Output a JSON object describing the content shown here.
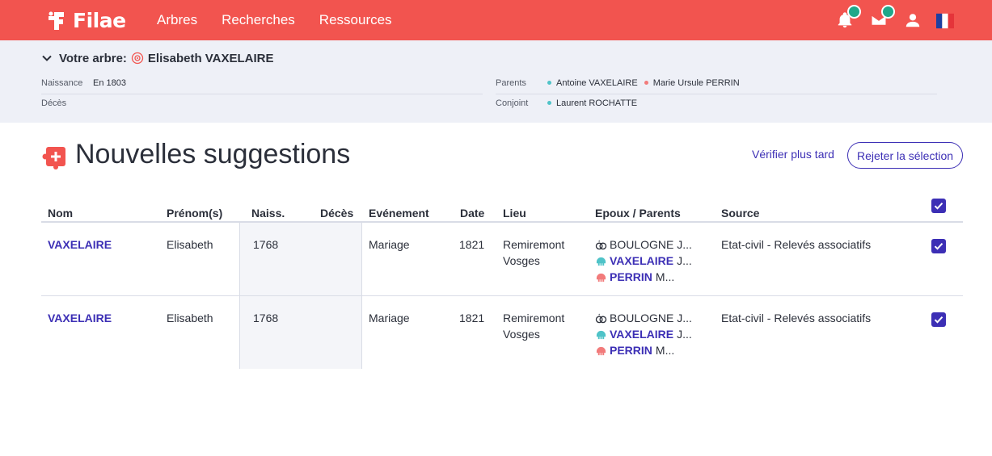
{
  "brand": {
    "name": "Filae"
  },
  "nav": {
    "items": [
      "Arbres",
      "Recherches",
      "Ressources"
    ]
  },
  "topbar": {
    "color": "#f2544f",
    "icons": [
      "bell-icon",
      "mail-icon",
      "user-icon",
      "french-flag-icon"
    ]
  },
  "tree": {
    "title_label": "Votre arbre:",
    "person": "Elisabeth VAXELAIRE",
    "birth_label": "Naissance",
    "birth_value": "En 1803",
    "death_label": "Décès",
    "death_value": "",
    "parents_label": "Parents",
    "parents": [
      "Antoine VAXELAIRE",
      "Marie Ursule PERRIN"
    ],
    "spouse_label": "Conjoint",
    "spouse": "Laurent ROCHATTE"
  },
  "suggestions": {
    "title": "Nouvelles suggestions",
    "later_label": "Vérifier plus tard",
    "reject_label": "Rejeter la sélection"
  },
  "table": {
    "headers": [
      "Nom",
      "Prénom(s)",
      "Naiss.",
      "Décès",
      "Evénement",
      "Date",
      "Lieu",
      "Epoux / Parents",
      "Source"
    ],
    "select_all_checked": true,
    "rows": [
      {
        "nom": "VAXELAIRE",
        "prenom": "Elisabeth",
        "naiss": "1768",
        "deces": "",
        "evenement": "Mariage",
        "date": "1821",
        "lieu_1": "Remiremont",
        "lieu_2": "Vosges",
        "epoux_name": "BOULOGNE J...",
        "pere_name": "VAXELAIRE",
        "pere_rest": "J...",
        "mere_name": "PERRIN",
        "mere_rest": "M...",
        "source": "Etat-civil - Relevés associatifs",
        "checked": true
      },
      {
        "nom": "VAXELAIRE",
        "prenom": "Elisabeth",
        "naiss": "1768",
        "deces": "",
        "evenement": "Mariage",
        "date": "1821",
        "lieu_1": "Remiremont",
        "lieu_2": "Vosges",
        "epoux_name": "BOULOGNE J...",
        "pere_name": "VAXELAIRE",
        "pere_rest": "J...",
        "mere_name": "PERRIN",
        "mere_rest": "M...",
        "source": "Etat-civil - Relevés associatifs",
        "checked": true
      }
    ]
  },
  "colors": {
    "accent": "#3c2fb5",
    "male": "#4fc3c8",
    "female": "#f27b7b",
    "notification": "#1fa88a"
  }
}
